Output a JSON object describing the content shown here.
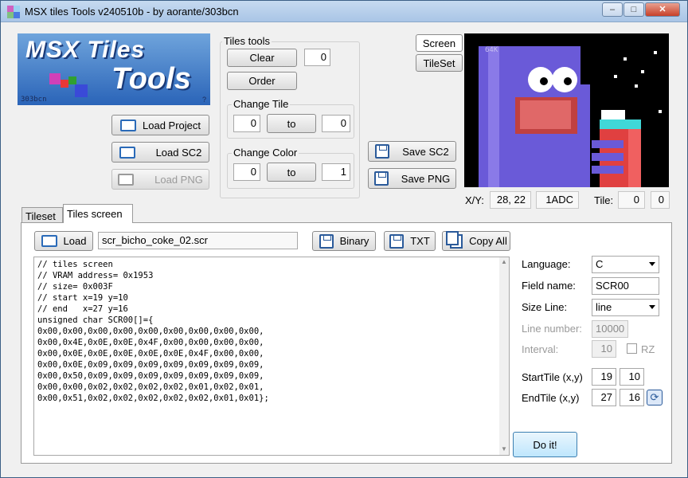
{
  "window": {
    "title": "MSX tiles Tools v240510b - by aorante/303bcn",
    "min": "–",
    "max": "□",
    "close": "✕"
  },
  "logo": {
    "line1": "MSX Tiles",
    "line2": "Tools",
    "author": "303bcn",
    "help": "?"
  },
  "file_buttons": {
    "load_project": "Load Project",
    "load_sc2": "Load SC2",
    "load_png": "Load PNG"
  },
  "tiles_tools": {
    "label": "Tiles tools",
    "clear": "Clear",
    "clear_value": "0",
    "order": "Order",
    "change_tile": {
      "label": "Change Tile",
      "from": "0",
      "to_label": "to",
      "to": "0"
    },
    "change_color": {
      "label": "Change Color",
      "from": "0",
      "to_label": "to",
      "to": "1"
    }
  },
  "save_buttons": {
    "save_sc2": "Save SC2",
    "save_png": "Save PNG"
  },
  "view_buttons": {
    "screen": "Screen",
    "tileset": "TileSet"
  },
  "screen_overlay": "64K",
  "status": {
    "xy_label": "X/Y:",
    "xy": "28, 22",
    "address": "1ADC",
    "tile_label": "Tile:",
    "tile": "0",
    "tile2": "0"
  },
  "tabs": [
    "Tileset",
    "Tiles screen"
  ],
  "toolbar": {
    "load": "Load",
    "filename": "scr_bicho_coke_02.scr",
    "binary": "Binary",
    "txt": "TXT",
    "copy_all": "Copy All"
  },
  "code": "// tiles screen\n// VRAM address= 0x1953\n// size= 0x003F\n// start x=19 y=10\n// end   x=27 y=16\nunsigned char SCR00[]={\n0x00,0x00,0x00,0x00,0x00,0x00,0x00,0x00,0x00,\n0x00,0x4E,0x0E,0x0E,0x4F,0x00,0x00,0x00,0x00,\n0x00,0x0E,0x0E,0x0E,0x0E,0x0E,0x4F,0x00,0x00,\n0x00,0x0E,0x09,0x09,0x09,0x09,0x09,0x09,0x09,\n0x00,0x50,0x09,0x09,0x09,0x09,0x09,0x09,0x09,\n0x00,0x00,0x02,0x02,0x02,0x02,0x01,0x02,0x01,\n0x00,0x51,0x02,0x02,0x02,0x02,0x02,0x01,0x01};",
  "options": {
    "language_label": "Language:",
    "language": "C",
    "field_label": "Field name:",
    "field": "SCR00",
    "size_line_label": "Size Line:",
    "size_line": "line",
    "line_number_label": "Line number:",
    "line_number": "10000",
    "interval_label": "Interval:",
    "interval": "10",
    "rz": "RZ",
    "start_label": "StartTile (x,y)",
    "start_x": "19",
    "start_y": "10",
    "end_label": "EndTile (x,y)",
    "end_x": "27",
    "end_y": "16",
    "doit": "Do it!"
  },
  "colors": {
    "accent": "#2a6ab8",
    "screen_blue": "#6a5ad8",
    "screen_red": "#e05050"
  }
}
